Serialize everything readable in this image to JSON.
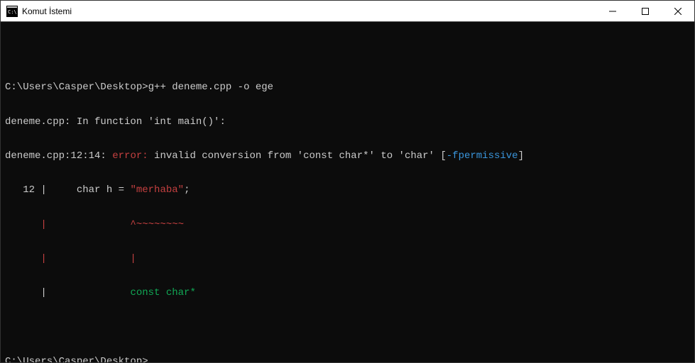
{
  "window": {
    "title": "Komut İstemi"
  },
  "terminal": {
    "line1_prompt": "C:\\Users\\Casper\\Desktop>",
    "line1_cmd": "g++ deneme.cpp -o ege",
    "line2": "deneme.cpp: In function 'int main()':",
    "line3_loc": "deneme.cpp:12:14: ",
    "line3_err": "error: ",
    "line3_msg1": "invalid conversion from '",
    "line3_type1": "const char*",
    "line3_msg2": "' to '",
    "line3_type2": "char",
    "line3_msg3": "' [",
    "line3_flag": "-fpermissive",
    "line3_msg4": "]",
    "line4_num": "   12 |     char h = ",
    "line4_str": "\"merhaba\"",
    "line4_end": ";",
    "line5": "      |              ^~~~~~~~~",
    "line6": "      |              |",
    "line7_pre": "      |              ",
    "line7_type": "const char*",
    "line8_prompt": "C:\\Users\\Casper\\Desktop>"
  }
}
